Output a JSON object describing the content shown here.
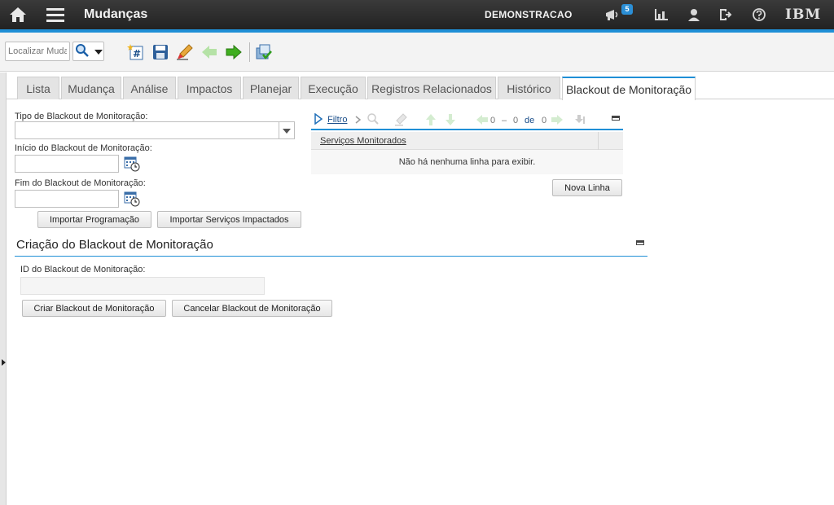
{
  "header": {
    "title": "Mudanças",
    "org": "DEMONSTRACAO",
    "notifications_count": "5",
    "brand": "IBM"
  },
  "toolbar": {
    "search_placeholder": "Localizar Muda"
  },
  "tabs": [
    {
      "label": "Lista"
    },
    {
      "label": "Mudança"
    },
    {
      "label": "Análise"
    },
    {
      "label": "Impactos"
    },
    {
      "label": "Planejar"
    },
    {
      "label": "Execução"
    },
    {
      "label": "Registros Relacionados"
    },
    {
      "label": "Histórico"
    },
    {
      "label": "Blackout de Monitoração"
    }
  ],
  "active_tab": "Blackout de Monitoração",
  "form": {
    "type_label": "Tipo de Blackout de Monitoração:",
    "type_value": "",
    "start_label": "Início do Blackout de Monitoração:",
    "start_value": "",
    "end_label": "Fim do Blackout de Monitoração:",
    "end_value": "",
    "import_schedule_button": "Importar Programação",
    "import_services_button": "Importar Serviços Impactados"
  },
  "table": {
    "filter_label": "Filtro",
    "pager": {
      "from": "0",
      "to": "0",
      "of_label": "de",
      "total": "0"
    },
    "column_header": "Serviços Monitorados",
    "empty_message": "Não há nenhuma linha para exibir.",
    "new_row_button": "Nova Linha"
  },
  "creation_section": {
    "title": "Criação do Blackout de Monitoração",
    "id_label": "ID do Blackout de Monitoração:",
    "id_value": "",
    "create_button": "Criar Blackout de Monitoração",
    "cancel_button": "Cancelar Blackout de Monitoração"
  },
  "colors": {
    "header_bg": "#2a2a2a",
    "accent": "#1f8fd6",
    "link": "#1a4e8a"
  }
}
